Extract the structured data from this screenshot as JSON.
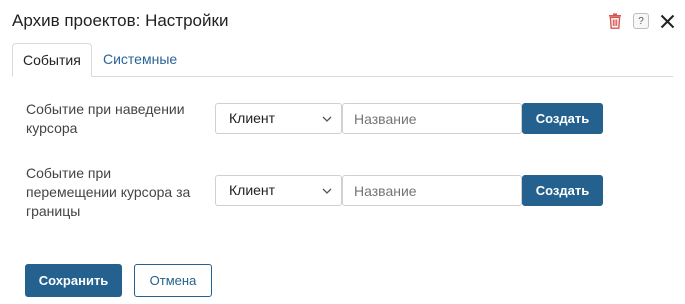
{
  "dialog": {
    "title": "Архив проектов: Настройки"
  },
  "header_icons": {
    "delete": "trash-icon",
    "help": "help-icon",
    "help_glyph": "?",
    "close": "close-icon",
    "delete_color": "#d9534f"
  },
  "tabs": [
    {
      "label": "События",
      "active": true
    },
    {
      "label": "Системные",
      "active": false
    }
  ],
  "events": [
    {
      "label": "Событие при наведении курсора",
      "type_value": "Клиент",
      "name_placeholder": "Название",
      "create_label": "Создать"
    },
    {
      "label": "Событие при перемещении курсора за границы",
      "type_value": "Клиент",
      "name_placeholder": "Название",
      "create_label": "Создать"
    }
  ],
  "footer": {
    "save_label": "Сохранить",
    "cancel_label": "Отмена"
  },
  "colors": {
    "accent": "#24618e",
    "link": "#2a6496"
  }
}
